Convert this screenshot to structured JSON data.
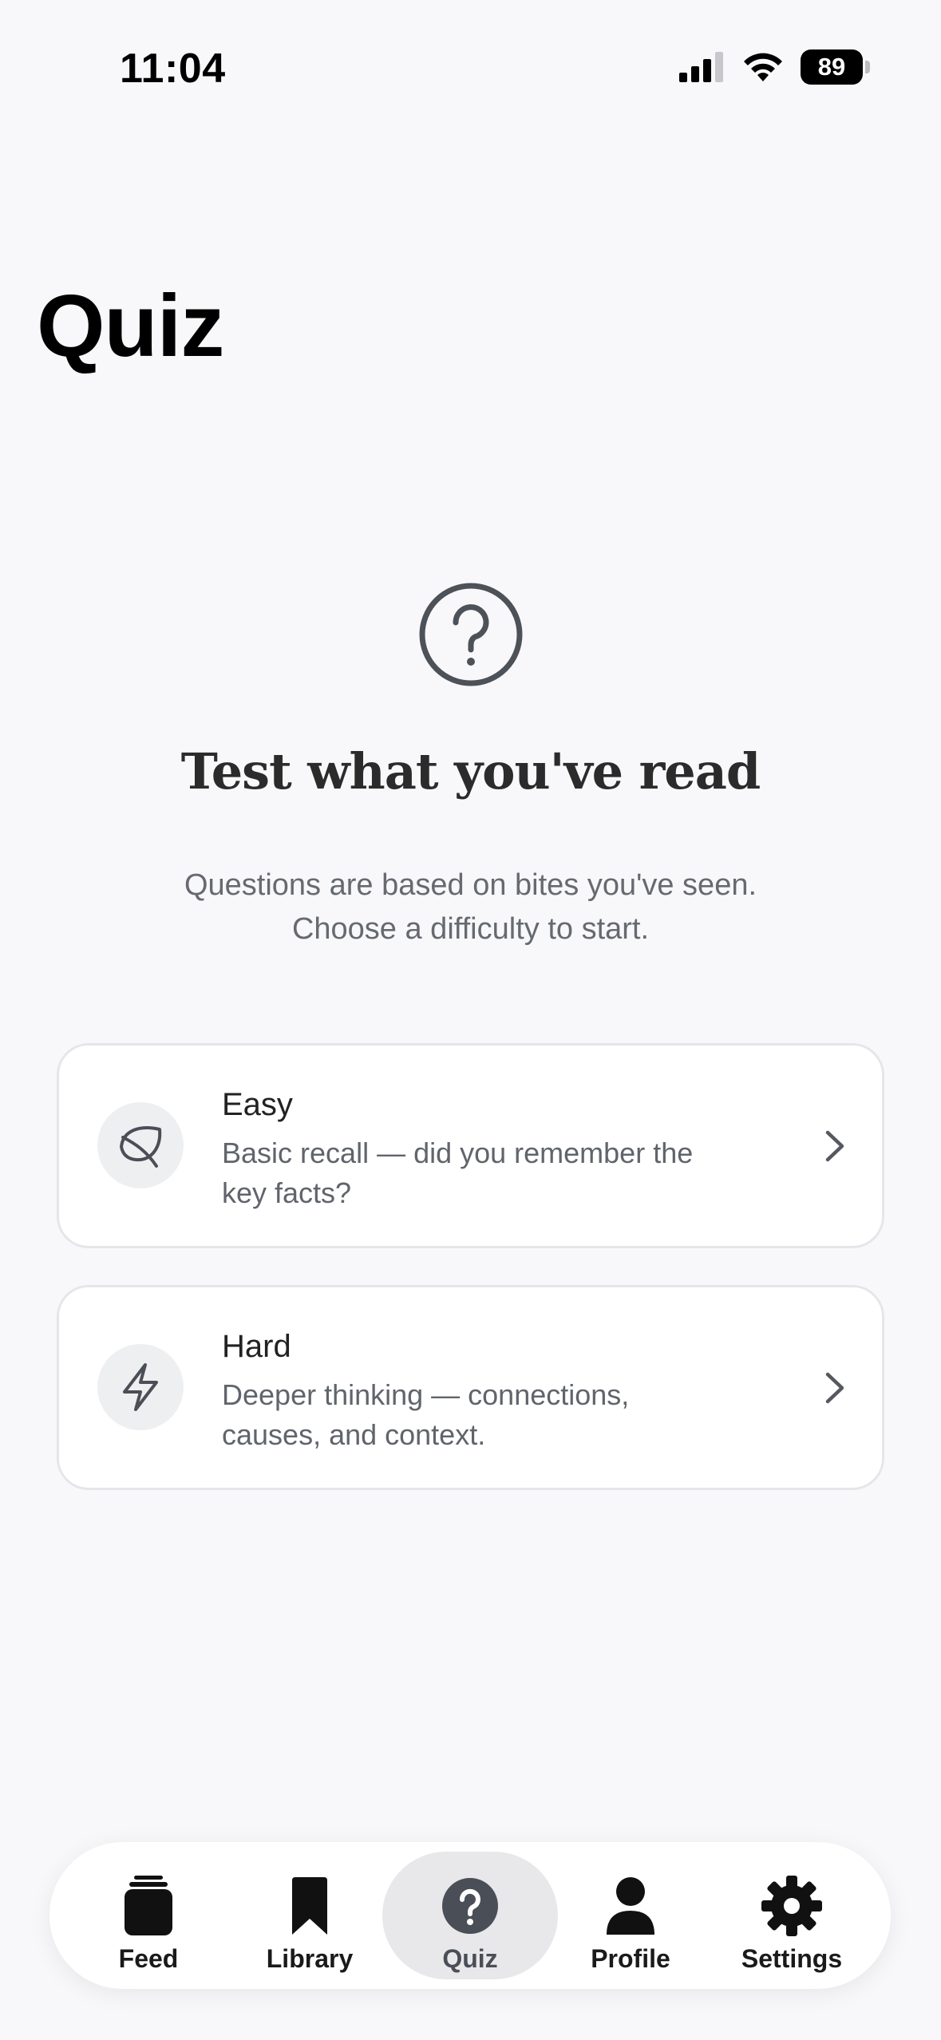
{
  "status_bar": {
    "time": "11:04",
    "battery": "89"
  },
  "page": {
    "title": "Quiz"
  },
  "hero": {
    "icon": "question-circle-icon",
    "heading": "Test what you've read",
    "subtitle_line1": "Questions are based on bites you've seen.",
    "subtitle_line2": "Choose a difficulty to start."
  },
  "difficulties": [
    {
      "title": "Easy",
      "description": "Basic recall — did you remember the key facts?",
      "icon": "leaf-icon"
    },
    {
      "title": "Hard",
      "description": "Deeper thinking — connections, causes, and context.",
      "icon": "lightning-icon"
    }
  ],
  "tabs": [
    {
      "label": "Feed",
      "icon": "feed-stack-icon",
      "active": false
    },
    {
      "label": "Library",
      "icon": "bookmark-icon",
      "active": false
    },
    {
      "label": "Quiz",
      "icon": "question-circle-icon",
      "active": true
    },
    {
      "label": "Profile",
      "icon": "person-icon",
      "active": false
    },
    {
      "label": "Settings",
      "icon": "gear-icon",
      "active": false
    }
  ],
  "colors": {
    "background": "#f8f8fa",
    "card": "#ffffff",
    "icon_gray": "#4a4e56",
    "active_tab": "#e8e8eb"
  }
}
